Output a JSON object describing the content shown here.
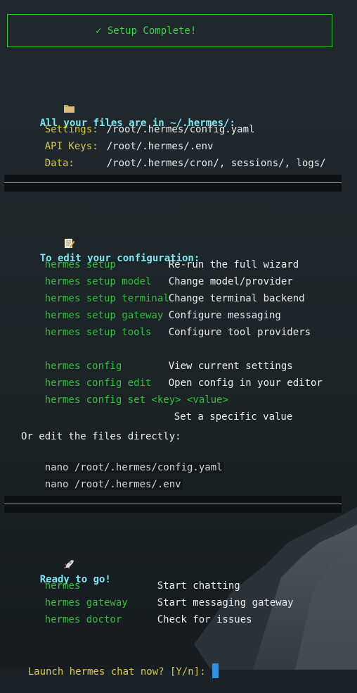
{
  "banner": {
    "text": "✓ Setup Complete!"
  },
  "files_section": {
    "heading": "All your files are in ~/.hermes/:",
    "icon": "folder-icon",
    "rows": [
      {
        "label": "Settings:",
        "value": "/root/.hermes/config.yaml"
      },
      {
        "label": "API Keys:",
        "value": "/root/.hermes/.env"
      },
      {
        "label": "Data:",
        "value": "/root/.hermes/cron/, sessions/, logs/"
      }
    ]
  },
  "config_section": {
    "heading": "To edit your configuration:",
    "icon": "memo-icon",
    "commands": [
      {
        "cmd": "hermes setup",
        "desc": "Re-run the full wizard"
      },
      {
        "cmd": "hermes setup model",
        "desc": "Change model/provider"
      },
      {
        "cmd": "hermes setup terminal",
        "desc": "Change terminal backend"
      },
      {
        "cmd": "hermes setup gateway",
        "desc": "Configure messaging"
      },
      {
        "cmd": "hermes setup tools",
        "desc": "Configure tool providers"
      },
      {
        "cmd": "hermes config",
        "desc": "View current settings"
      },
      {
        "cmd": "hermes config edit",
        "desc": "Open config in your editor"
      },
      {
        "cmd": "hermes config set <key> <value>",
        "desc": "Set a specific value"
      }
    ],
    "direct_edit_label": "Or edit the files directly:",
    "direct_edit_commands": [
      "nano /root/.hermes/config.yaml",
      "nano /root/.hermes/.env"
    ]
  },
  "ready_section": {
    "heading": "Ready to go!",
    "icon": "rocket-icon",
    "commands": [
      {
        "cmd": "hermes",
        "desc": "Start chatting"
      },
      {
        "cmd": "hermes gateway",
        "desc": "Start messaging gateway"
      },
      {
        "cmd": "hermes doctor",
        "desc": "Check for issues"
      }
    ]
  },
  "prompt": {
    "text": "Launch hermes chat now? [Y/n]: "
  },
  "colors": {
    "banner_border": "#2fbf3a",
    "heading": "#7fe6ef",
    "label_yellow": "#d8c64a",
    "command_green": "#2fbf3a",
    "prompt_yellow": "#d8c64a",
    "cursor": "#2f8fe0",
    "background": "#1b2227"
  }
}
